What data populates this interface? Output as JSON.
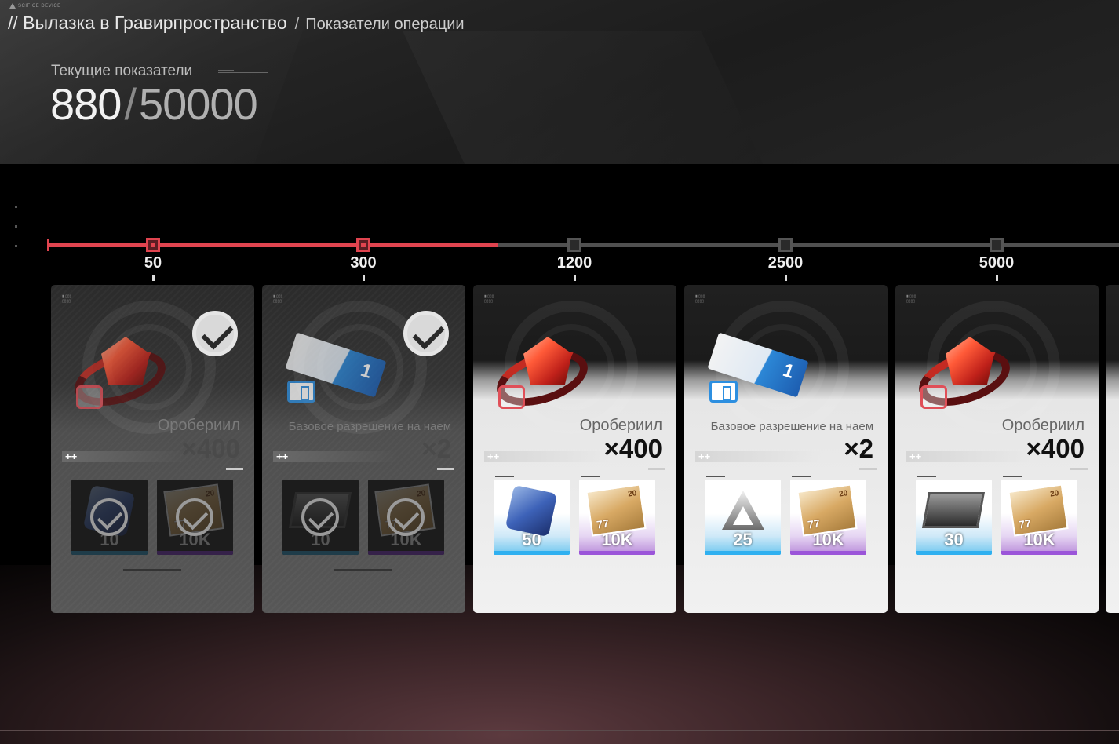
{
  "header": {
    "logo_text": "SCIFICE DEVICE",
    "breadcrumb_main": "// Вылазка в Гравирпространство",
    "breadcrumb_separator": "/",
    "breadcrumb_sub": "Показатели операции"
  },
  "progress": {
    "label": "Текущие показатели",
    "current": "880",
    "separator": "/",
    "goal": "50000",
    "current_value": 880
  },
  "milestones": [
    {
      "value": "50",
      "claimed": true
    },
    {
      "value": "300",
      "claimed": true
    },
    {
      "value": "1200",
      "claimed": false
    },
    {
      "value": "2500",
      "claimed": false
    },
    {
      "value": "5000",
      "claimed": false
    }
  ],
  "cards": [
    {
      "item_name": "Оробериил",
      "item_qty": "×400",
      "tiles": [
        {
          "label": "10",
          "color": "blue"
        },
        {
          "label": "10K",
          "color": "purple"
        }
      ]
    },
    {
      "item_name": "Базовое разрешение на наем",
      "item_qty": "×2",
      "tiles": [
        {
          "label": "10",
          "color": "blue"
        },
        {
          "label": "10K",
          "color": "purple"
        }
      ]
    },
    {
      "item_name": "Оробериил",
      "item_qty": "×400",
      "tiles": [
        {
          "label": "50",
          "color": "blue"
        },
        {
          "label": "10K",
          "color": "purple"
        }
      ]
    },
    {
      "item_name": "Базовое разрешение на наем",
      "item_qty": "×2",
      "tiles": [
        {
          "label": "25",
          "color": "blue"
        },
        {
          "label": "10K",
          "color": "purple"
        }
      ]
    },
    {
      "item_name": "Оробериил",
      "item_qty": "×400",
      "tiles": [
        {
          "label": "30",
          "color": "blue"
        },
        {
          "label": "10K",
          "color": "purple"
        }
      ]
    }
  ],
  "colors": {
    "accent": "#e0444f",
    "track": "#505050",
    "blue_rarity": "#2fb0f0",
    "purple_rarity": "#9b55d9"
  }
}
